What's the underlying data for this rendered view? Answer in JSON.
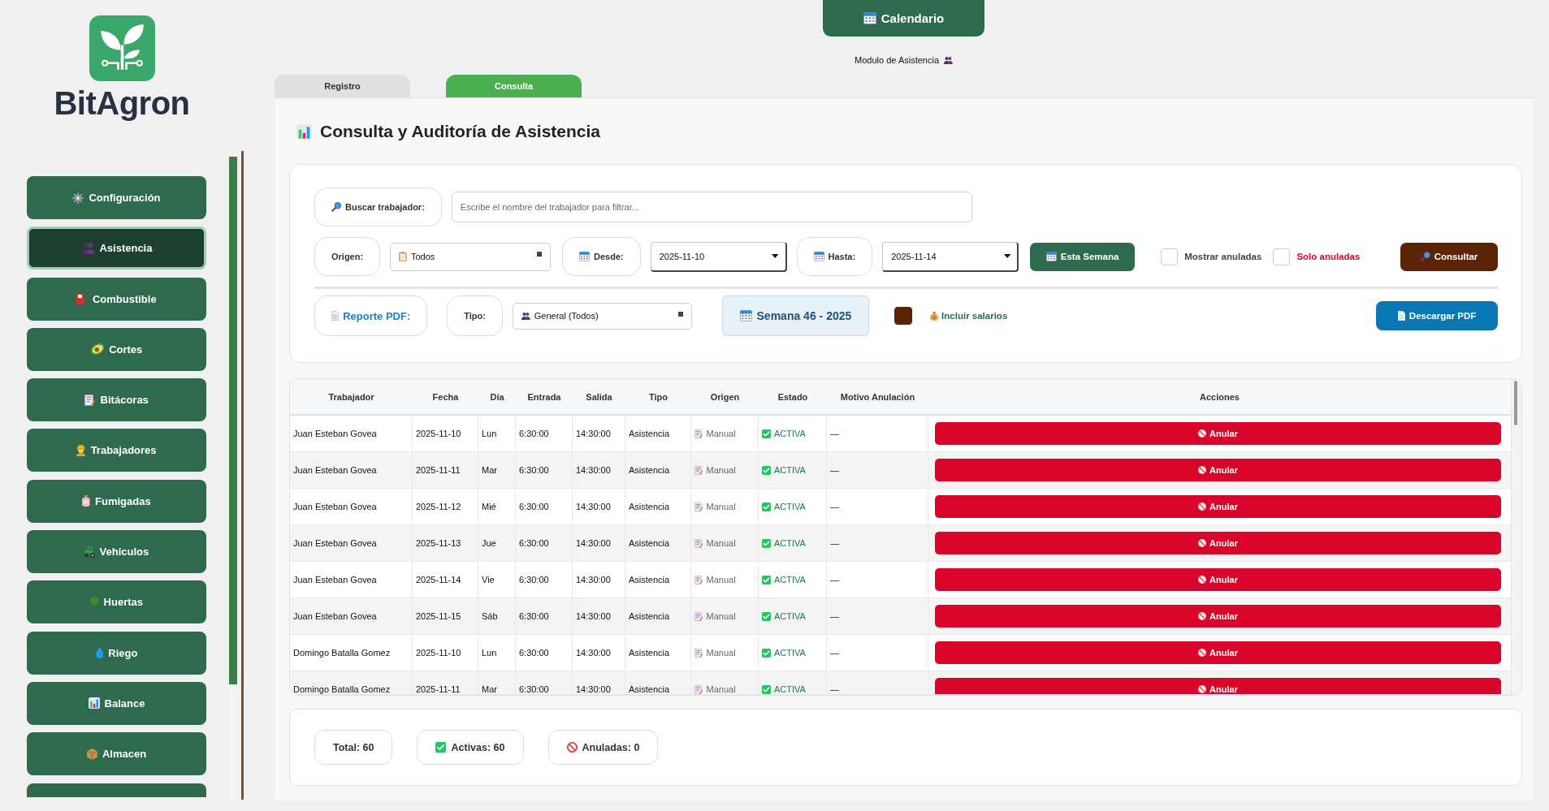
{
  "brand": {
    "name": "BitAgron"
  },
  "sidebar": {
    "items": [
      {
        "label": "Configuración",
        "selected": false
      },
      {
        "label": "Asistencia",
        "selected": true
      },
      {
        "label": "Combustible",
        "selected": false
      },
      {
        "label": "Cortes",
        "selected": false
      },
      {
        "label": "Bitácoras",
        "selected": false
      },
      {
        "label": "Trabajadores",
        "selected": false
      },
      {
        "label": "Fumigadas",
        "selected": false
      },
      {
        "label": "Vehiculos",
        "selected": false
      },
      {
        "label": "Huertas",
        "selected": false
      },
      {
        "label": "Riego",
        "selected": false
      },
      {
        "label": "Balance",
        "selected": false
      },
      {
        "label": "Almacen",
        "selected": false
      },
      {
        "selected": false
      }
    ]
  },
  "header": {
    "calendar_button": "Calendario",
    "module_label": "Modulo de Asistencia"
  },
  "tabs": [
    {
      "label": "Registro",
      "selected": false
    },
    {
      "label": "Consulta",
      "selected": true
    }
  ],
  "page_title": "Consulta y Auditoría de Asistencia",
  "filters": {
    "search": {
      "label": "Buscar trabajador:",
      "placeholder": "Escribe el nombre del trabajador para filtrar..."
    },
    "origin": {
      "label": "Origen:",
      "value": "Todos"
    },
    "date_from": {
      "label": "Desde:",
      "value": "2025-11-10"
    },
    "date_to": {
      "label": "Hasta:",
      "value": "2025-11-14"
    },
    "week_button": "Esta Semana",
    "checkboxes": [
      {
        "label": "Mostrar anuladas",
        "checked": false,
        "kind": "default"
      },
      {
        "label": "Solo anuladas",
        "checked": false,
        "kind": "danger"
      }
    ],
    "query_button": "Consultar"
  },
  "report": {
    "label": "Reporte PDF:",
    "type": {
      "label": "Tipo:",
      "value": "General (Todos)"
    },
    "week_label": "Semana 46 - 2025",
    "include_salaries": {
      "label": "Incluir salarios",
      "checked": true
    },
    "download_button": "Descargar PDF"
  },
  "table": {
    "columns": [
      "Trabajador",
      "Fecha",
      "Día",
      "Entrada",
      "Salida",
      "Tipo",
      "Origen",
      "Estado",
      "Motivo Anulación",
      "Acciones"
    ],
    "rows": [
      {
        "worker": "Juan Esteban Govea",
        "date": "2025-11-10",
        "day": "Lun",
        "check_in": "6:30:00",
        "check_out": "14:30:00",
        "type": "Asistencia",
        "origin": "Manual",
        "status": "ACTIVA",
        "reason": "—",
        "action": "Anular"
      },
      {
        "worker": "Juan Esteban Govea",
        "date": "2025-11-11",
        "day": "Mar",
        "check_in": "6:30:00",
        "check_out": "14:30:00",
        "type": "Asistencia",
        "origin": "Manual",
        "status": "ACTIVA",
        "reason": "—",
        "action": "Anular"
      },
      {
        "worker": "Juan Esteban Govea",
        "date": "2025-11-12",
        "day": "Mié",
        "check_in": "6:30:00",
        "check_out": "14:30:00",
        "type": "Asistencia",
        "origin": "Manual",
        "status": "ACTIVA",
        "reason": "—",
        "action": "Anular"
      },
      {
        "worker": "Juan Esteban Govea",
        "date": "2025-11-13",
        "day": "Jue",
        "check_in": "6:30:00",
        "check_out": "14:30:00",
        "type": "Asistencia",
        "origin": "Manual",
        "status": "ACTIVA",
        "reason": "—",
        "action": "Anular"
      },
      {
        "worker": "Juan Esteban Govea",
        "date": "2025-11-14",
        "day": "Vie",
        "check_in": "6:30:00",
        "check_out": "14:30:00",
        "type": "Asistencia",
        "origin": "Manual",
        "status": "ACTIVA",
        "reason": "—",
        "action": "Anular"
      },
      {
        "worker": "Juan Esteban Govea",
        "date": "2025-11-15",
        "day": "Sáb",
        "check_in": "6:30:00",
        "check_out": "14:30:00",
        "type": "Asistencia",
        "origin": "Manual",
        "status": "ACTIVA",
        "reason": "—",
        "action": "Anular"
      },
      {
        "worker": "Domingo Batalla Gomez",
        "date": "2025-11-10",
        "day": "Lun",
        "check_in": "6:30:00",
        "check_out": "14:30:00",
        "type": "Asistencia",
        "origin": "Manual",
        "status": "ACTIVA",
        "reason": "—",
        "action": "Anular"
      },
      {
        "worker": "Domingo Batalla Gomez",
        "date": "2025-11-11",
        "day": "Mar",
        "check_in": "6:30:00",
        "check_out": "14:30:00",
        "type": "Asistencia",
        "origin": "Manual",
        "status": "ACTIVA",
        "reason": "—",
        "action": "Anular"
      }
    ]
  },
  "summary": [
    {
      "kind": "total",
      "text": "Total: 60"
    },
    {
      "kind": "active",
      "text": "Activas: 60"
    },
    {
      "kind": "voided",
      "text": "Anuladas: 0"
    }
  ]
}
